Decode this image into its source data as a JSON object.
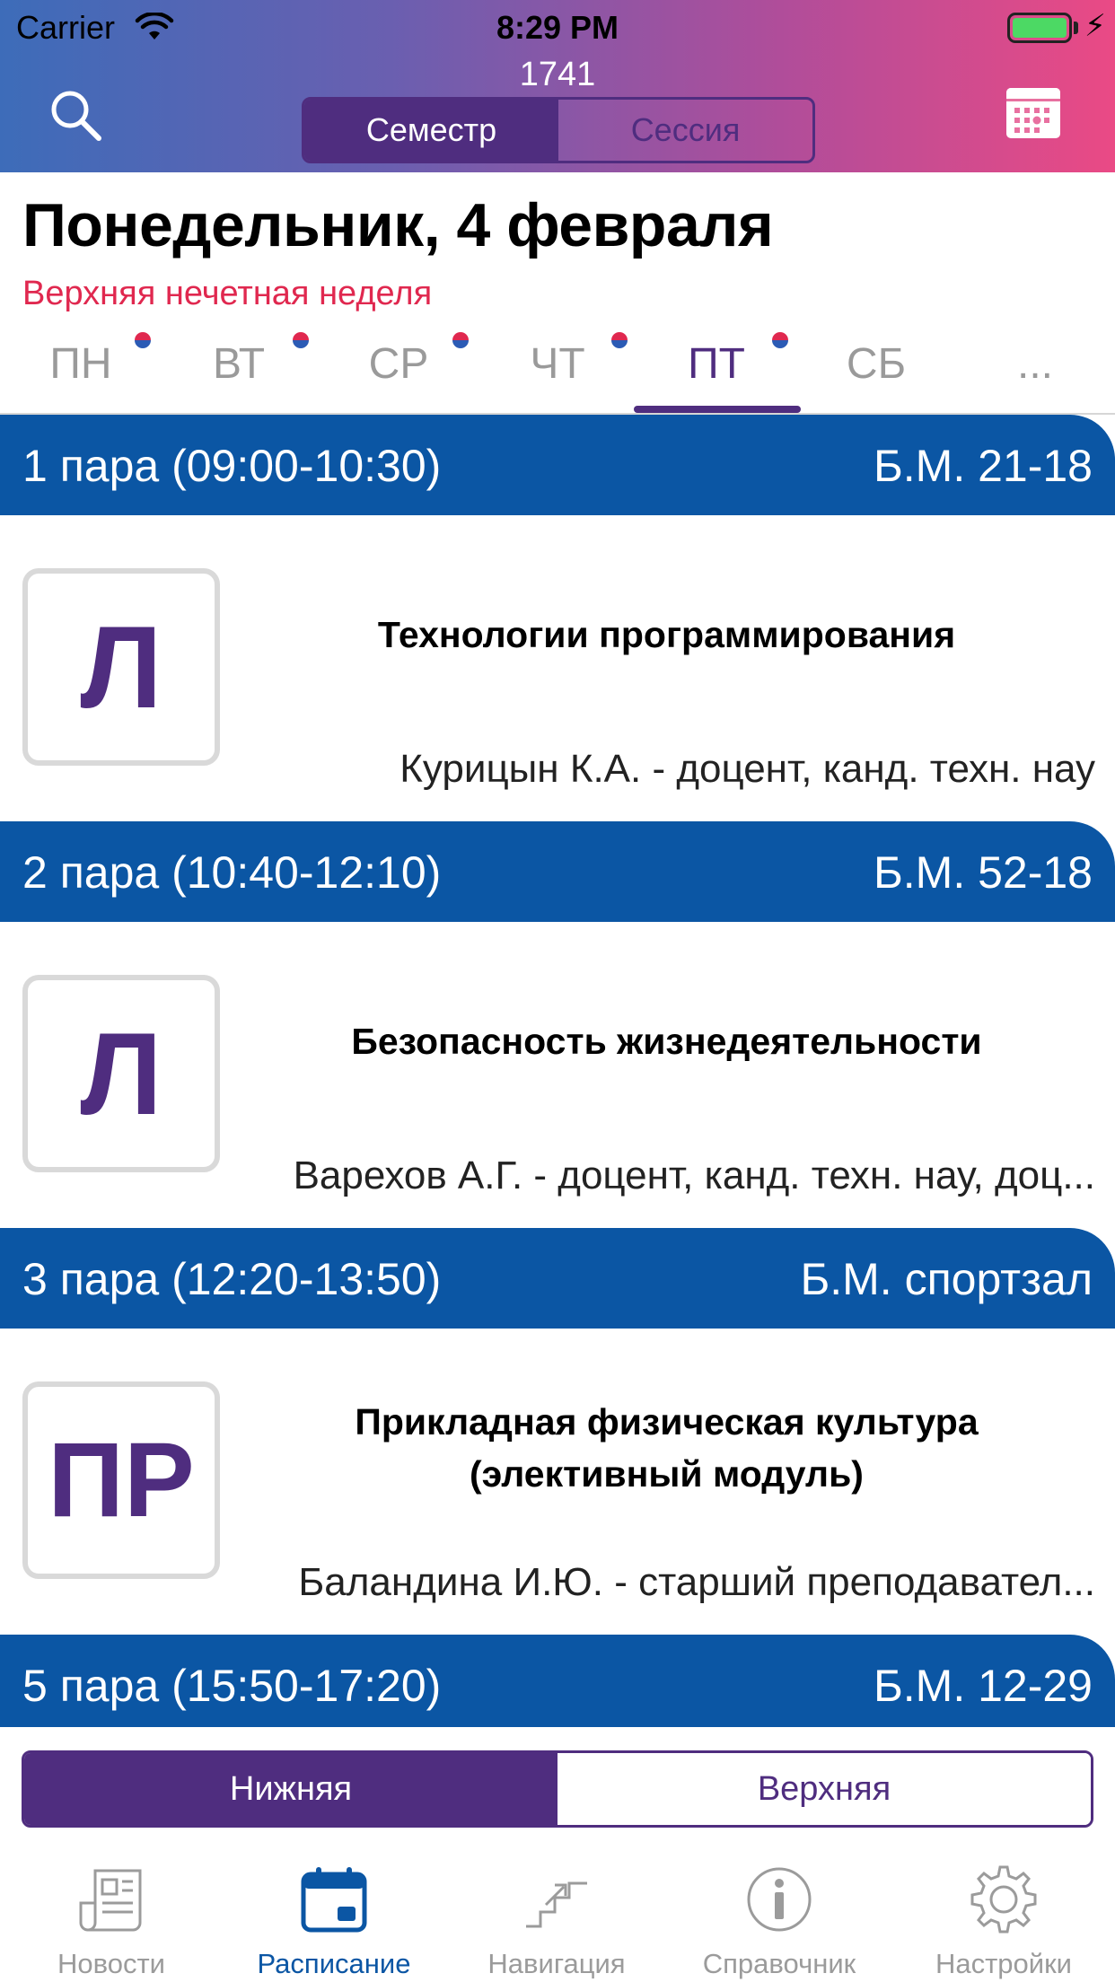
{
  "status_bar": {
    "carrier": "Carrier",
    "time": "8:29 PM"
  },
  "header": {
    "group_number": "1741",
    "segments": [
      {
        "label": "Семестр",
        "selected": true
      },
      {
        "label": "Сессия",
        "selected": false
      }
    ],
    "gradient_colors": [
      "#3d6cb9",
      "#ea4a85"
    ]
  },
  "date": {
    "title": "Понедельник, 4 февраля",
    "week_type": "Верхняя нечетная неделя"
  },
  "days": [
    {
      "label": "ПН",
      "has_dot": true,
      "selected": false
    },
    {
      "label": "ВТ",
      "has_dot": true,
      "selected": false
    },
    {
      "label": "СР",
      "has_dot": true,
      "selected": false
    },
    {
      "label": "ЧТ",
      "has_dot": true,
      "selected": false
    },
    {
      "label": "ПТ",
      "has_dot": true,
      "selected": true
    },
    {
      "label": "СБ",
      "has_dot": false,
      "selected": false
    },
    {
      "label": "...",
      "has_dot": false,
      "selected": false
    }
  ],
  "lessons": [
    {
      "pair": "1 пара (09:00-10:30)",
      "room": "Б.М. 21-18",
      "type": "Л",
      "subject": "Технологии программирования",
      "teacher": "Курицын К.А. - доцент, канд. техн. нау"
    },
    {
      "pair": "2 пара (10:40-12:10)",
      "room": "Б.М. 52-18",
      "type": "Л",
      "subject": "Безопасность жизнедеятельности",
      "teacher": "Варехов А.Г. - доцент, канд. техн. нау, доц..."
    },
    {
      "pair": "3 пара (12:20-13:50)",
      "room": "Б.М. спортзал",
      "type": "ПР",
      "subject": "Прикладная физическая культура (элективный модуль)",
      "teacher": "Баландина И.Ю. - старший преподавател..."
    },
    {
      "pair": "5 пара (15:50-17:20)",
      "room": "Б.М. 12-29"
    }
  ],
  "week_toggle": [
    {
      "label": "Нижняя",
      "selected": true
    },
    {
      "label": "Верхняя",
      "selected": false
    }
  ],
  "tabbar": [
    {
      "label": "Новости",
      "icon": "newspaper-icon",
      "selected": false
    },
    {
      "label": "Расписание",
      "icon": "calendar-icon",
      "selected": true
    },
    {
      "label": "Навигация",
      "icon": "stairs-icon",
      "selected": false
    },
    {
      "label": "Справочник",
      "icon": "info-icon",
      "selected": false
    },
    {
      "label": "Настройки",
      "icon": "gear-icon",
      "selected": false
    }
  ],
  "colors": {
    "accent_purple": "#4f2d7f",
    "pair_header_blue": "#0b56a4",
    "week_type_red": "#e0284f",
    "tab_active": "#0b56a4",
    "tab_inactive": "#9b9b9b"
  }
}
